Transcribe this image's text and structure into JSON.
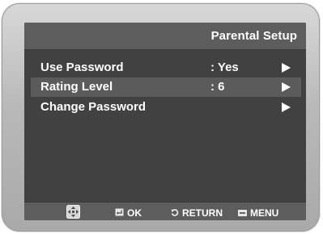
{
  "window": {
    "title": "Parental Setup"
  },
  "menu": {
    "items": [
      {
        "label": "Use Password",
        "value": ": Yes",
        "selected": false,
        "icon": "chevron-right-icon"
      },
      {
        "label": "Rating Level",
        "value": ": 6",
        "selected": true,
        "icon": "chevron-right-icon"
      },
      {
        "label": "Change Password",
        "value": "",
        "selected": false,
        "icon": "chevron-right-icon"
      }
    ]
  },
  "footer": {
    "nav_icon": "dpad-icon",
    "ok_label": "OK",
    "ok_icon": "enter-icon",
    "return_label": "RETURN",
    "return_icon": "return-icon",
    "menu_label": "MENU",
    "menu_icon": "menu-icon"
  },
  "colors": {
    "screen_bg": "#414141",
    "bar_bg": "#5d5d5d",
    "highlight": "#5b5b5b",
    "text": "#ffffff",
    "bezel": "#b9b9b9"
  }
}
